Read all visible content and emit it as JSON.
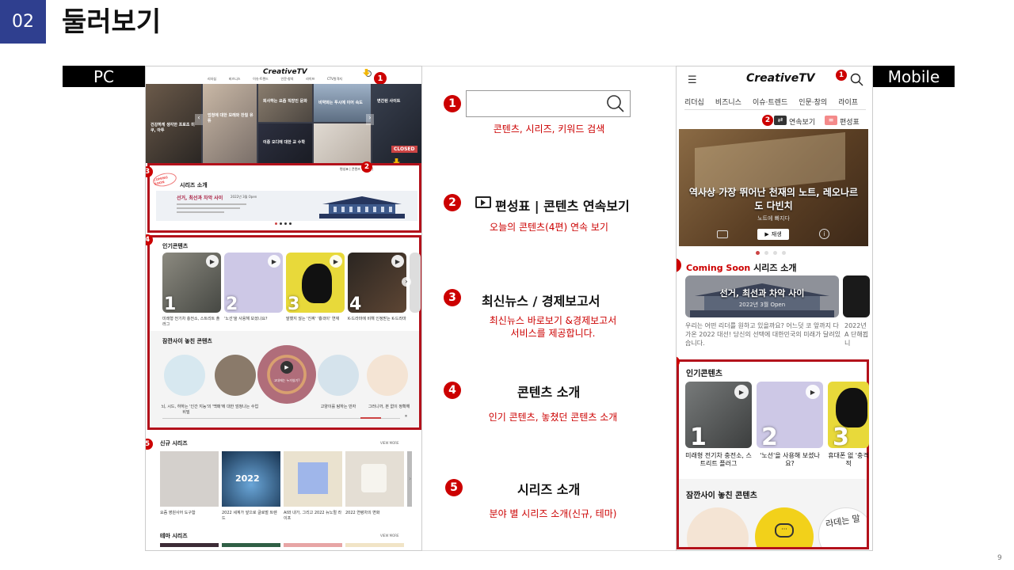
{
  "slide": {
    "number": "02",
    "title": "둘러보기",
    "page": "9"
  },
  "labels": {
    "pc": "PC",
    "mobile": "Mobile"
  },
  "features": [
    {
      "num": "1",
      "desc": "콘텐츠, 시리즈, 키워드 검색"
    },
    {
      "num": "2",
      "title": "편성표 | 콘텐츠 연속보기",
      "desc": "오늘의 콘텐츠(4편) 연속 보기"
    },
    {
      "num": "3",
      "title": "최신뉴스 / 경제보고서",
      "desc1": "최신뉴스 바로보기 &경제보고서",
      "desc2": "서비스를 제공합니다."
    },
    {
      "num": "4",
      "title": "콘텐츠 소개",
      "desc": "인기 콘텐츠, 놓쳤던 콘텐츠 소개"
    },
    {
      "num": "5",
      "title": "시리즈 소개",
      "desc": "분야 별 시리즈 소개(신규, 테마)"
    }
  ],
  "pc": {
    "logo": "CreativeTV",
    "nav": [
      "리더십",
      "비즈니스",
      "이슈·트렌드",
      "인문·창의",
      "라이프",
      "CTV원격지"
    ],
    "hero_captions": [
      "건강하게 생각한 프로초 미쿠, 아투",
      "엄청에 대한 모래와 잔칠 유튜",
      "퇴사하는 요즘 직장인 문화",
      "비약화는 투시에 이어 속도",
      "이중 오디에 대한 교 수학",
      "변간된 사이트",
      "CLOSED"
    ],
    "series_section": {
      "badge": "COMING SOON",
      "title": "시리즈 소개",
      "subtitle": "선거, 최선과 차악 사이",
      "date": "2022년 3월 Open",
      "topbar": "편성표 | 콘텐츠 연속보기"
    },
    "popular": {
      "title": "인기콘텐츠",
      "ranks": [
        "1",
        "2",
        "3",
        "4"
      ],
      "captions": [
        "미래형 전기차 충전소, 스트리트 플러그",
        "'노선'을 사용해 보셨나요?",
        "말했지 않는 '진짜' '흉곽이' 연재",
        "K-드라마에 비해 인정받는 K-드라마"
      ]
    },
    "missed": {
      "title": "잠깐사이 놓친 콘텐츠",
      "center_label": "고대에는 누가썼기?",
      "captions": [
        "뇌, 시드, 하하는 '인간 지능'의 비밀",
        "'백매'에 대한 엄청나는 수업",
        "고양이를 탐하는 만자",
        "그러니까, 본 없이 정확해"
      ]
    },
    "new_series": {
      "title": "신규 시리즈",
      "more": "VIEW MORE",
      "year": "2022",
      "captions": [
        "요즘 영원사어 도구함",
        "2022 세계가 앞으로 글로벌 트렌드",
        "AI와 내가, 그리고 2022 뉴노멀 라이프",
        "2022 연령차의 변화"
      ]
    },
    "theme_series": {
      "title": "테마 시리즈",
      "more": "VIEW MORE"
    }
  },
  "mobile": {
    "logo": "CreativeTV",
    "tabs": [
      "리더십",
      "비즈니스",
      "이슈·트렌드",
      "인문·창의",
      "라이프"
    ],
    "continuous": "연속보기",
    "schedule": "편성표",
    "hero_title": "역사상 가장 뛰어난 천재의 노트, 레오나르도 다빈치",
    "hero_sub": "노트에 빠지다",
    "play": "재생",
    "series": {
      "badge": "Coming Soon",
      "title": "시리즈 소개",
      "card_title": "선거, 최선과 차악 사이",
      "card_date": "2022년 3월 Open",
      "desc": "우리는 어떤 리더를 원하고 있을까요? 어느덧 코 앞까지 다가온 2022 대선! 당신의 선택에 대한민국의 미래가 달려있습니다.",
      "desc2": "2022년 A 단해뵙니"
    },
    "popular": {
      "title": "인기콘텐츠",
      "ranks": [
        "1",
        "2",
        "3"
      ],
      "captions": [
        "미래형 전기차 충전소, 스트리트 플러그",
        "'노선'을 사용해 보셨나요?",
        "휴대폰 없 '충격적"
      ]
    },
    "missed": {
      "title": "잠깐사이 놓친 콘텐츠",
      "handwriting": "라데는 말"
    }
  },
  "colors": {
    "accent": "#b3111b",
    "badge": "#c00000",
    "slide_num_bg": "#2f3f8f",
    "label_bg": "#000000"
  }
}
